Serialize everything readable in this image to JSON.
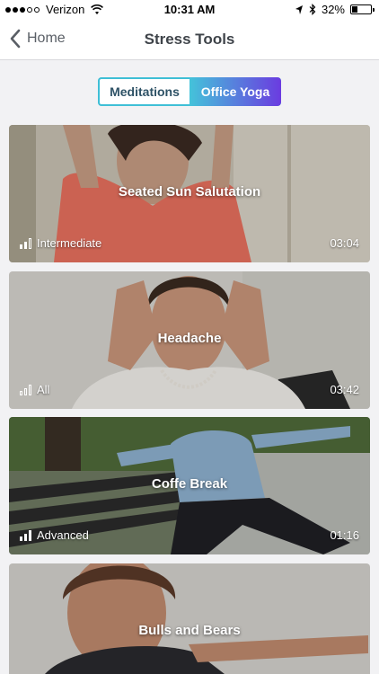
{
  "status_bar": {
    "carrier": "Verizon",
    "time": "10:31 AM",
    "battery": "32%",
    "battery_level": 0.32
  },
  "nav": {
    "back_label": "Home",
    "title": "Stress Tools"
  },
  "tabs": [
    {
      "label": "Meditations",
      "active": false
    },
    {
      "label": "Office Yoga",
      "active": true
    }
  ],
  "cards": [
    {
      "title": "Seated Sun Salutation",
      "level": "Intermediate",
      "level_bars": 2,
      "duration": "03:04"
    },
    {
      "title": "Headache",
      "level": "All",
      "level_bars": 0,
      "duration": "03:42"
    },
    {
      "title": "Coffe Break",
      "level": "Advanced",
      "level_bars": 3,
      "duration": "01:16"
    },
    {
      "title": "Bulls and Bears",
      "level": "",
      "level_bars": 0,
      "duration": ""
    }
  ]
}
